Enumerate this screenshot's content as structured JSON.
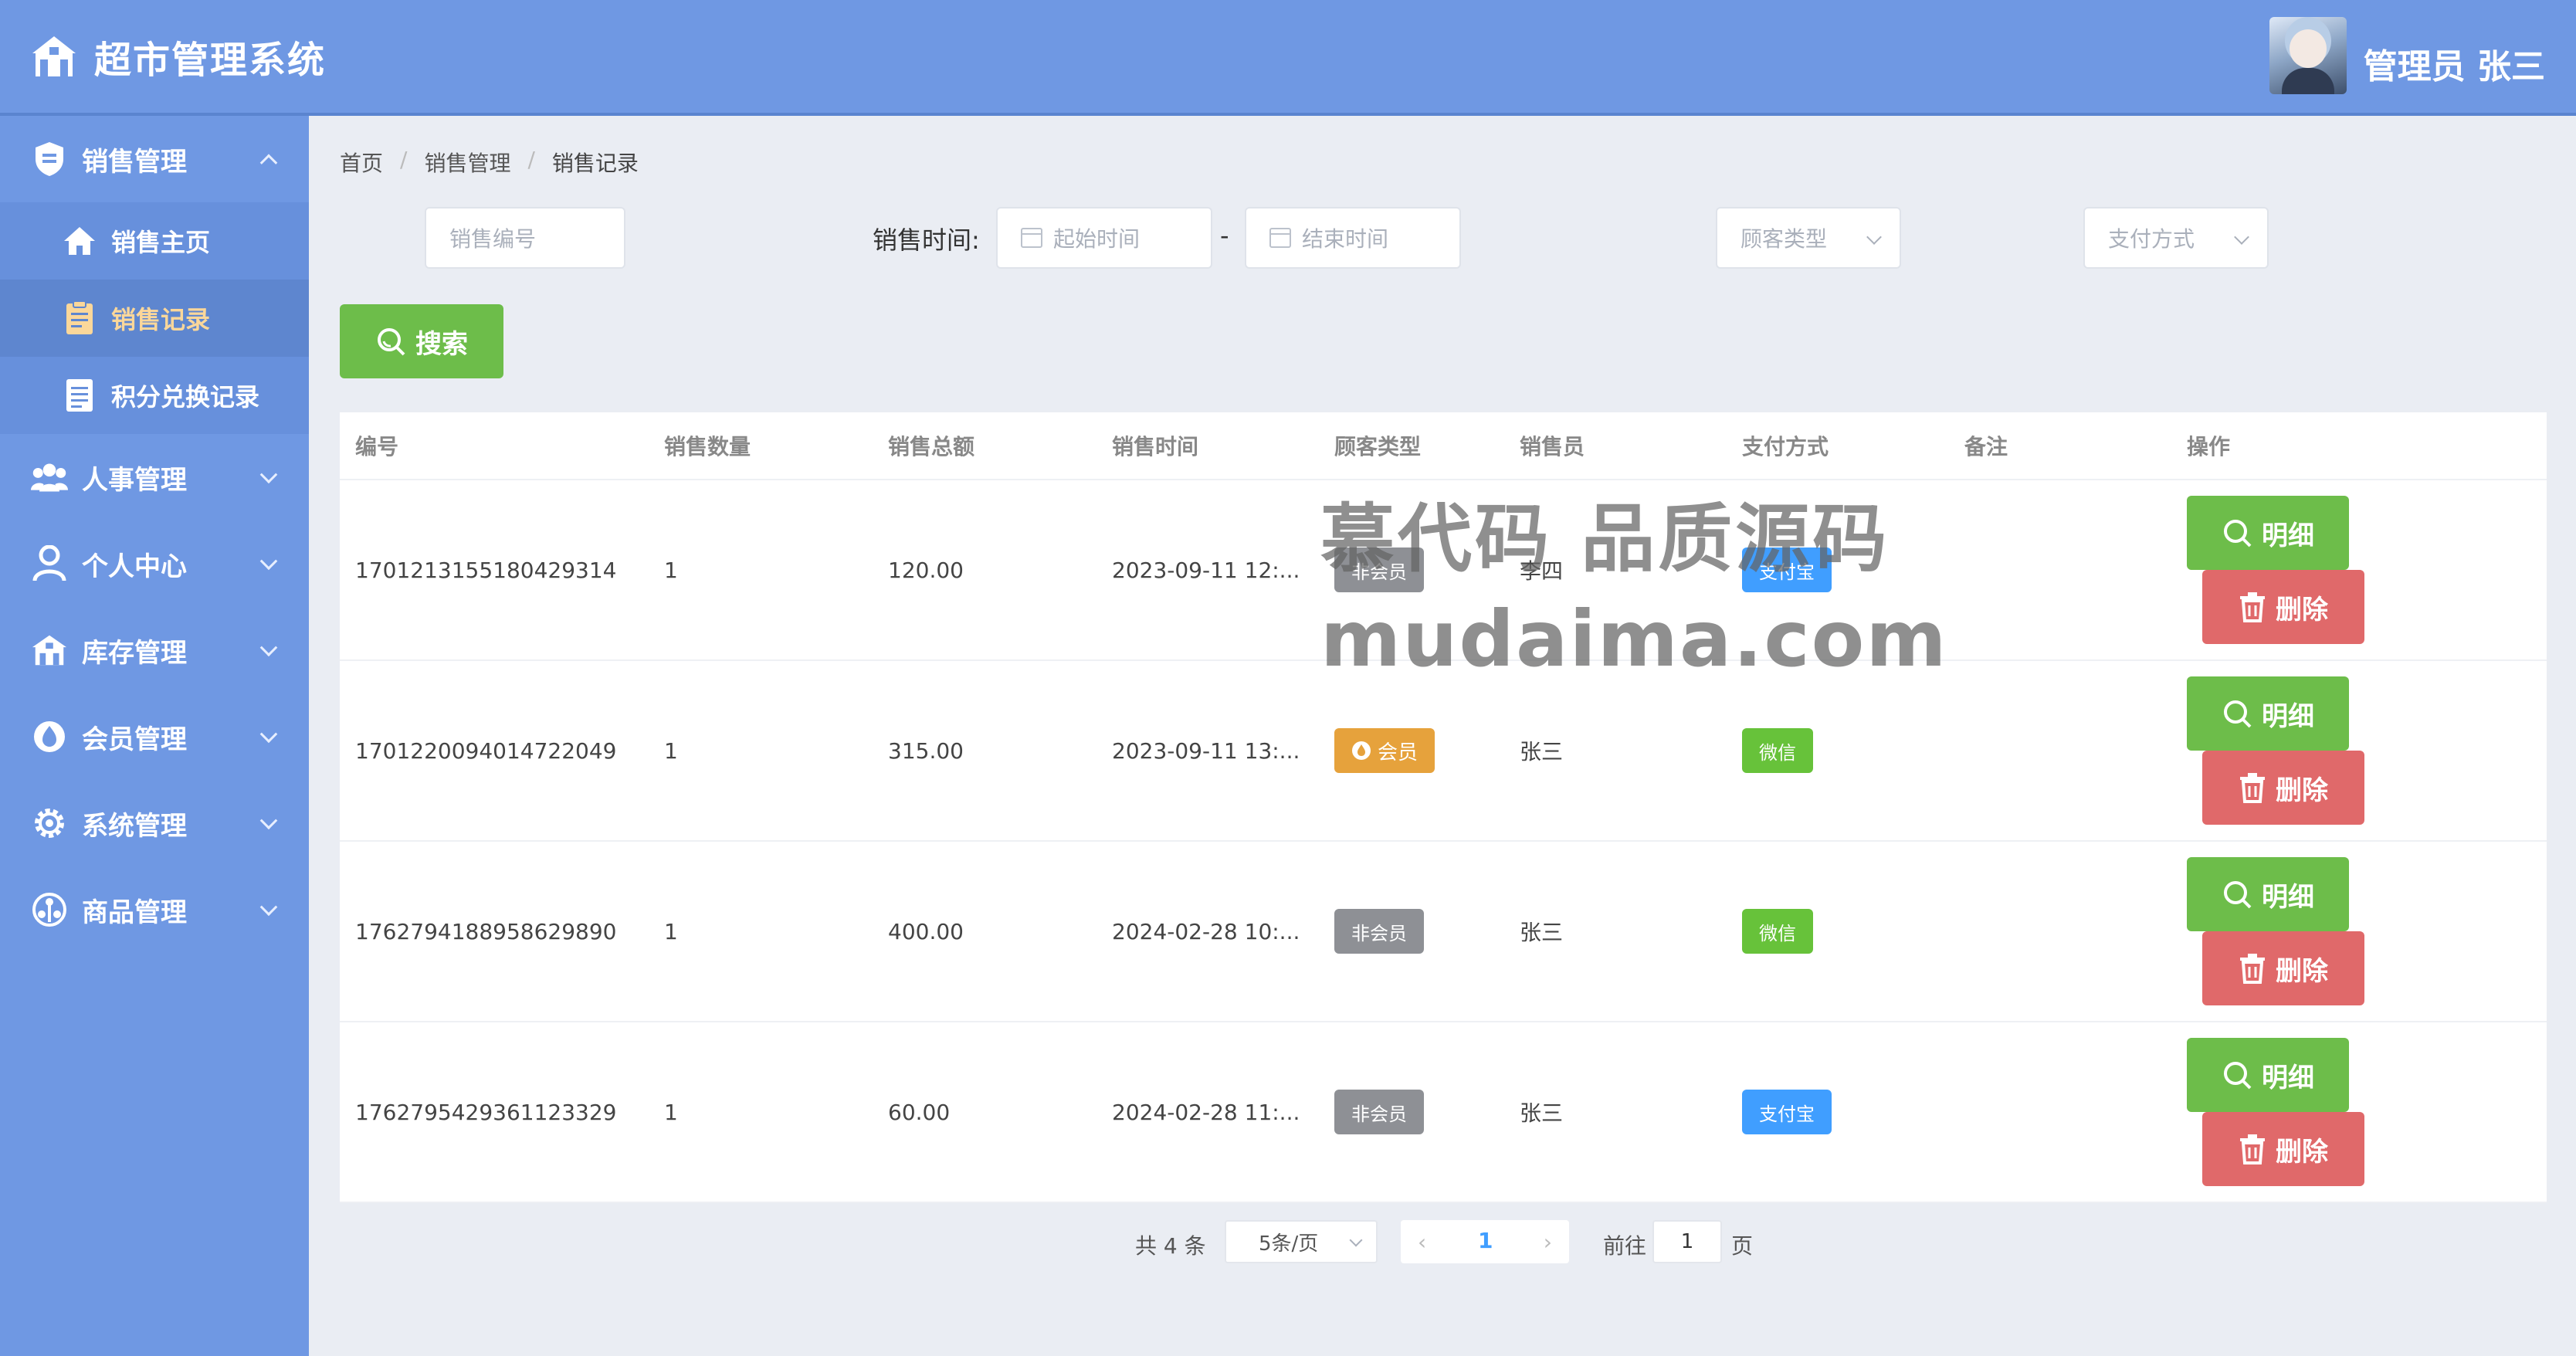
{
  "app": {
    "title": "超市管理系统",
    "user": "管理员 张三"
  },
  "sidebar": {
    "groups": [
      {
        "label": "销售管理",
        "icon": "shield-icon",
        "expanded": true
      },
      {
        "label": "人事管理",
        "icon": "people-icon"
      },
      {
        "label": "个人中心",
        "icon": "person-icon"
      },
      {
        "label": "库存管理",
        "icon": "warehouse-icon"
      },
      {
        "label": "会员管理",
        "icon": "drop-icon"
      },
      {
        "label": "系统管理",
        "icon": "gear-icon"
      },
      {
        "label": "商品管理",
        "icon": "goods-icon"
      }
    ],
    "sub_items": [
      {
        "label": "销售主页",
        "icon": "home-icon"
      },
      {
        "label": "销售记录",
        "icon": "list-icon",
        "active": true
      },
      {
        "label": "积分兑换记录",
        "icon": "doc-icon"
      }
    ]
  },
  "breadcrumb": [
    "首页",
    "销售管理",
    "销售记录"
  ],
  "filters": {
    "sale_no_placeholder": "销售编号",
    "time_label": "销售时间:",
    "start_placeholder": "起始时间",
    "dash": "-",
    "end_placeholder": "结束时间",
    "customer_type_placeholder": "顾客类型",
    "pay_method_placeholder": "支付方式",
    "search_label": "搜索"
  },
  "table": {
    "headers": [
      "编号",
      "销售数量",
      "销售总额",
      "销售时间",
      "顾客类型",
      "销售员",
      "支付方式",
      "备注",
      "操作"
    ],
    "rows": [
      {
        "id": "1701213155180429314",
        "qty": "1",
        "total": "120.00",
        "time": "2023-09-11 12:...",
        "customer": "非会员",
        "customer_kind": "non",
        "seller": "李四",
        "pay": "支付宝",
        "pay_kind": "ali",
        "note": ""
      },
      {
        "id": "1701220094014722049",
        "qty": "1",
        "total": "315.00",
        "time": "2023-09-11 13:...",
        "customer": "会员",
        "customer_kind": "vip",
        "seller": "张三",
        "pay": "微信",
        "pay_kind": "wx",
        "note": ""
      },
      {
        "id": "1762794188958629890",
        "qty": "1",
        "total": "400.00",
        "time": "2024-02-28 10:...",
        "customer": "非会员",
        "customer_kind": "non",
        "seller": "张三",
        "pay": "微信",
        "pay_kind": "wx",
        "note": ""
      },
      {
        "id": "1762795429361123329",
        "qty": "1",
        "total": "60.00",
        "time": "2024-02-28 11:...",
        "customer": "非会员",
        "customer_kind": "non",
        "seller": "张三",
        "pay": "支付宝",
        "pay_kind": "ali",
        "note": ""
      }
    ],
    "detail_label": "明细",
    "delete_label": "删除"
  },
  "pager": {
    "total": "共 4 条",
    "page_size": "5条/页",
    "current": "1",
    "goto_label": "前往",
    "goto_value": "1",
    "page_word": "页"
  },
  "watermark": {
    "line1": "慕代码 品质源码",
    "line2": "mudaima.com"
  },
  "colors": {
    "primary": "#6f98e3",
    "success": "#6dbd4a",
    "danger": "#e0696a",
    "info": "#409eff",
    "warning": "#e6a23c"
  }
}
